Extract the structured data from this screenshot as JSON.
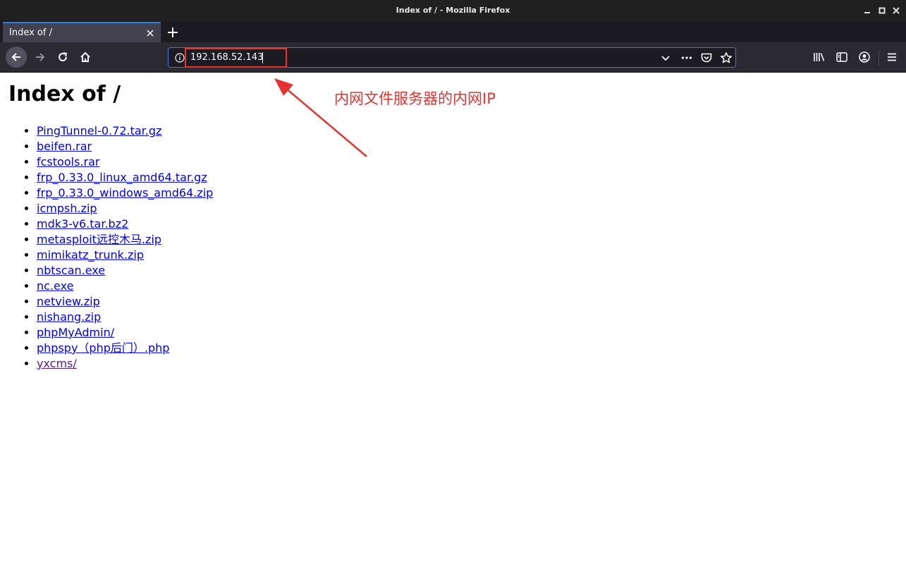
{
  "window": {
    "title": "Index of / - Mozilla Firefox"
  },
  "tabs": [
    {
      "label": "Index of /",
      "active": true
    }
  ],
  "navbar": {
    "url": "192.168.52.143"
  },
  "page": {
    "heading": "Index of /",
    "files": [
      {
        "name": "PingTunnel-0.72.tar.gz",
        "visited": false
      },
      {
        "name": "beifen.rar",
        "visited": false
      },
      {
        "name": "fcstools.rar",
        "visited": false
      },
      {
        "name": "frp_0.33.0_linux_amd64.tar.gz",
        "visited": false
      },
      {
        "name": "frp_0.33.0_windows_amd64.zip",
        "visited": false
      },
      {
        "name": "icmpsh.zip",
        "visited": false
      },
      {
        "name": "mdk3-v6.tar.bz2",
        "visited": false
      },
      {
        "name": "metasploit远控木马.zip",
        "visited": false
      },
      {
        "name": "mimikatz_trunk.zip",
        "visited": false
      },
      {
        "name": "nbtscan.exe",
        "visited": false
      },
      {
        "name": "nc.exe",
        "visited": false
      },
      {
        "name": "netview.zip",
        "visited": false
      },
      {
        "name": "nishang.zip",
        "visited": false
      },
      {
        "name": "phpMyAdmin/",
        "visited": false
      },
      {
        "name": "phpspy（php后门）.php",
        "visited": false
      },
      {
        "name": "yxcms/",
        "visited": true
      }
    ]
  },
  "annotation": {
    "text": "内网文件服务器的内网IP",
    "color": "#e8302e"
  },
  "colors": {
    "link": "#0000ee",
    "visited_link": "#551a8b",
    "accent": "#3a7ae0"
  }
}
